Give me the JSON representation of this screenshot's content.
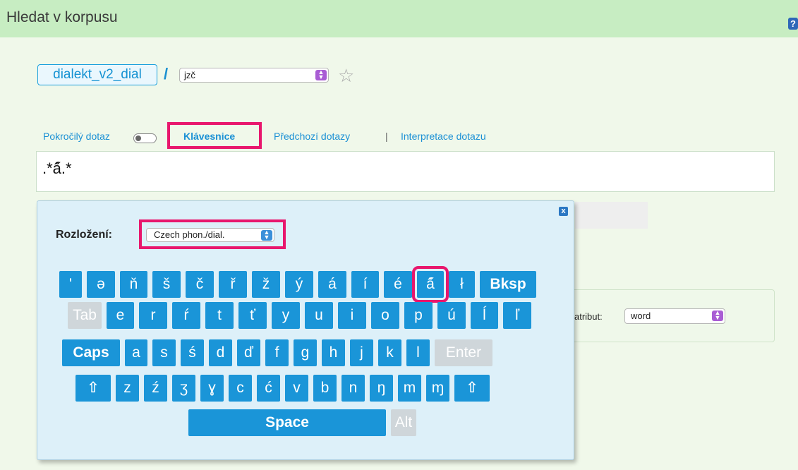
{
  "header": {
    "title": "Hledat v korpusu",
    "help_icon_glyph": "?"
  },
  "corpus": {
    "name": "dialekt_v2_dial",
    "slash": "/",
    "subcorpus": "jzč",
    "star_glyph": "☆"
  },
  "toolbar": {
    "advanced_query": "Pokročilý dotaz",
    "keyboard": "Klávesnice",
    "previous_queries": "Předchozí dotazy",
    "separator": "|",
    "interpretation": "Interpretace dotazu"
  },
  "query": {
    "value": ".*á̋.*"
  },
  "keyboard": {
    "close_glyph": "x",
    "layout_label": "Rozložení:",
    "layout_value": "Czech phon./dial.",
    "rows": [
      [
        {
          "label": "ʹ",
          "w": 32
        },
        {
          "label": "ə",
          "w": 40
        },
        {
          "label": "ň",
          "w": 39
        },
        {
          "label": "š",
          "w": 40
        },
        {
          "label": "č",
          "w": 40
        },
        {
          "label": "ř",
          "w": 40
        },
        {
          "label": "ž",
          "w": 40
        },
        {
          "label": "ý",
          "w": 40
        },
        {
          "label": "á",
          "w": 40
        },
        {
          "label": "í",
          "w": 39
        },
        {
          "label": "é",
          "w": 40
        },
        {
          "label": "á̋",
          "w": 38,
          "hl": true
        },
        {
          "label": "ł",
          "w": 37
        },
        {
          "label": "Bksp",
          "w": 80,
          "bold": true
        }
      ],
      [
        {
          "label": "Tab",
          "w": 48,
          "dis": true
        },
        {
          "label": "e",
          "w": 39
        },
        {
          "label": "r",
          "w": 40
        },
        {
          "label": "ŕ",
          "w": 40
        },
        {
          "label": "t",
          "w": 40
        },
        {
          "label": "ť",
          "w": 40
        },
        {
          "label": "y",
          "w": 40
        },
        {
          "label": "u",
          "w": 40
        },
        {
          "label": "i",
          "w": 40
        },
        {
          "label": "o",
          "w": 40
        },
        {
          "label": "p",
          "w": 40
        },
        {
          "label": "ú",
          "w": 40
        },
        {
          "label": "ĺ",
          "w": 39
        },
        {
          "label": "ľ",
          "w": 40
        }
      ],
      [
        {
          "label": "Caps",
          "w": 82,
          "bold": true
        },
        {
          "label": "a",
          "w": 32
        },
        {
          "label": "s",
          "w": 33
        },
        {
          "label": "ś",
          "w": 33
        },
        {
          "label": "d",
          "w": 33
        },
        {
          "label": "ď",
          "w": 33
        },
        {
          "label": "f",
          "w": 33
        },
        {
          "label": "g",
          "w": 33
        },
        {
          "label": "h",
          "w": 33
        },
        {
          "label": "j",
          "w": 33
        },
        {
          "label": "k",
          "w": 33
        },
        {
          "label": "l",
          "w": 33
        },
        {
          "label": "Enter",
          "w": 82,
          "dis": true
        }
      ],
      [
        {
          "label": "⇧",
          "w": 50,
          "bold": true
        },
        {
          "label": "z",
          "w": 33
        },
        {
          "label": "ź",
          "w": 33
        },
        {
          "label": "ʒ",
          "w": 33
        },
        {
          "label": "ɣ",
          "w": 33
        },
        {
          "label": "c",
          "w": 33
        },
        {
          "label": "ć",
          "w": 33
        },
        {
          "label": "v",
          "w": 33
        },
        {
          "label": "b",
          "w": 33
        },
        {
          "label": "n",
          "w": 33
        },
        {
          "label": "ŋ",
          "w": 33
        },
        {
          "label": "m",
          "w": 33
        },
        {
          "label": "ɱ",
          "w": 33
        },
        {
          "label": "⇧",
          "w": 50,
          "bold": true
        }
      ],
      [
        {
          "label": "Space",
          "w": 280,
          "bold": true
        },
        {
          "label": "Alt",
          "w": 36,
          "dis": true
        }
      ]
    ]
  },
  "background_form": {
    "attr_label": "atribut:",
    "attr_value": "word"
  }
}
